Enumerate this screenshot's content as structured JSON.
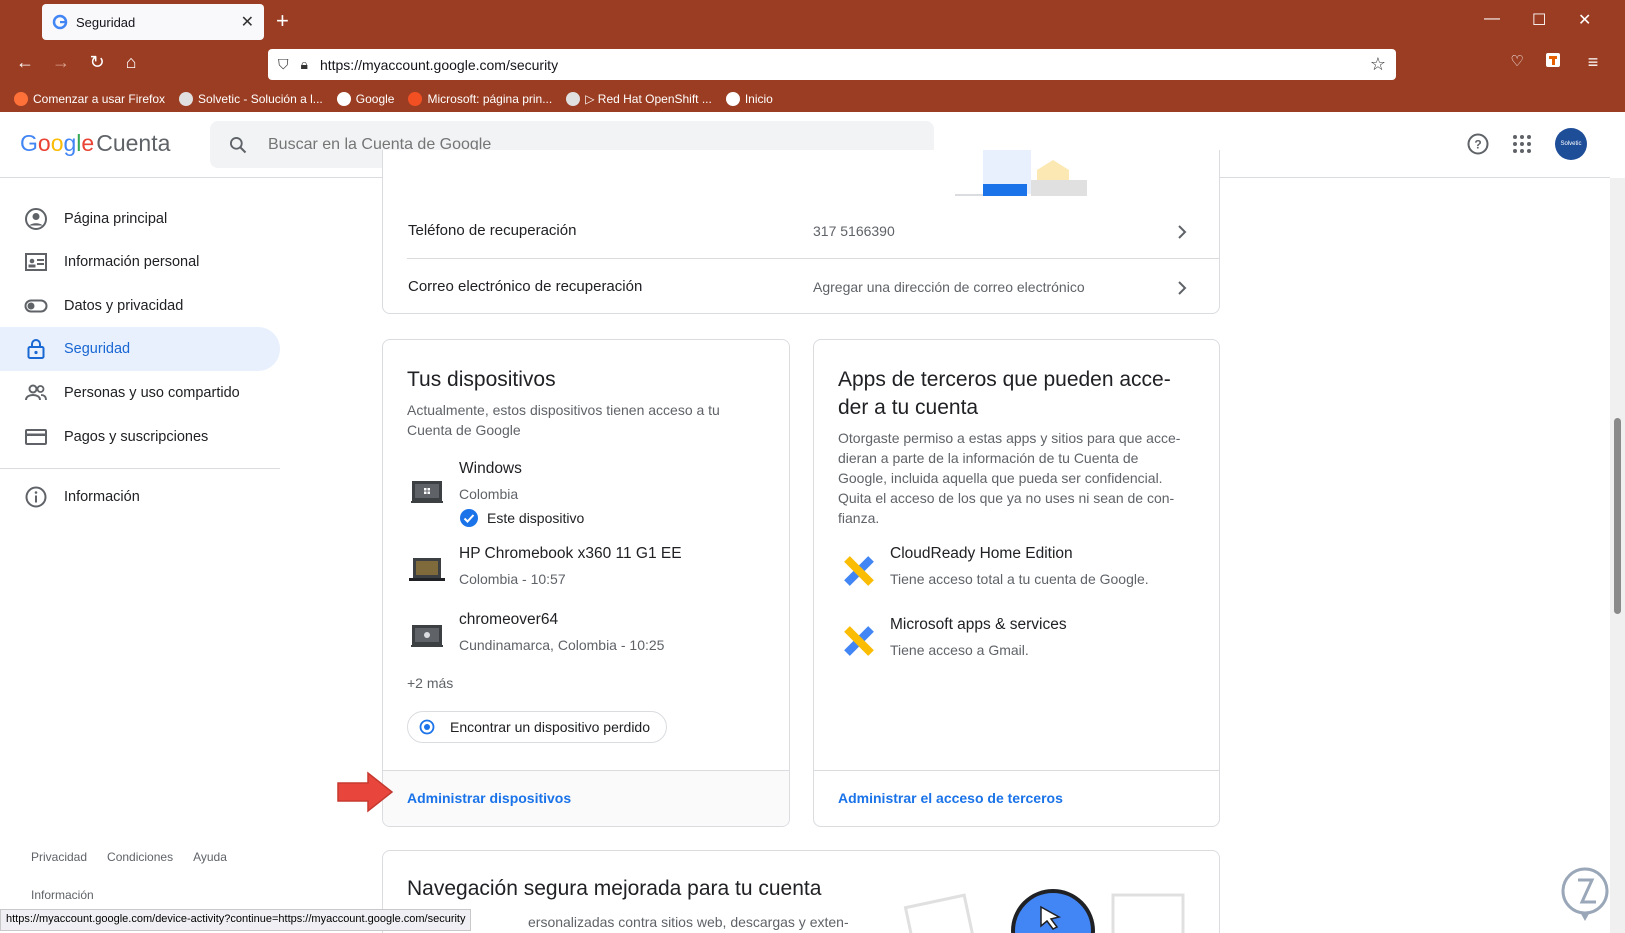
{
  "browser": {
    "tab_title": "Seguridad",
    "url": "https://myaccount.google.com/security",
    "bookmarks": [
      {
        "label": "Comenzar a usar Firefox",
        "color": "#ff7139"
      },
      {
        "label": "Solvetic - Solución a l...",
        "color": "#e0e0e0"
      },
      {
        "label": "Google",
        "color": "#ffffff"
      },
      {
        "label": "Microsoft: página prin...",
        "color": "#f25022"
      },
      {
        "label": "▷ Red Hat OpenShift ...",
        "color": "#e0e0e0"
      },
      {
        "label": "Inicio",
        "color": "#ffffff"
      }
    ],
    "status_url": "https://myaccount.google.com/device-activity?continue=https://myaccount.google.com/security"
  },
  "header": {
    "logo_google": "Google",
    "logo_cuenta": "Cuenta",
    "search_placeholder": "Buscar en la Cuenta de Google",
    "avatar_text": "Solvetic"
  },
  "sidebar": {
    "items": [
      {
        "label": "Página principal",
        "icon": "account-circle-icon"
      },
      {
        "label": "Información personal",
        "icon": "id-card-icon"
      },
      {
        "label": "Datos y privacidad",
        "icon": "toggle-icon"
      },
      {
        "label": "Seguridad",
        "icon": "lock-icon"
      },
      {
        "label": "Personas y uso compartido",
        "icon": "people-icon"
      },
      {
        "label": "Pagos y suscripciones",
        "icon": "credit-card-icon"
      }
    ],
    "info_label": "Información",
    "footer": {
      "privacy": "Privacidad",
      "terms": "Condiciones",
      "help": "Ayuda",
      "info": "Información"
    }
  },
  "recovery": {
    "phone_label": "Teléfono de recuperación",
    "phone_value": "317 5166390",
    "email_label": "Correo electrónico de recuperación",
    "email_value": "Agregar una dirección de correo electrónico"
  },
  "devices": {
    "title": "Tus dispositivos",
    "desc_1": "Actualmente, estos dispositivos tienen acceso a tu",
    "desc_2": "Cuenta de Google",
    "list": [
      {
        "name": "Windows",
        "sub": "Colombia",
        "badge": "Este dispositivo"
      },
      {
        "name": "HP Chromebook x360 11 G1 EE",
        "sub": "Colombia - 10:57"
      },
      {
        "name": "chromeover64",
        "sub": "Cundinamarca, Colombia - 10:25"
      }
    ],
    "more": "+2 más",
    "find_button": "Encontrar un dispositivo perdido",
    "manage_link": "Administrar dispositivos"
  },
  "third_party": {
    "title_1": "Apps de terceros que pueden acce-",
    "title_2": "der a tu cuenta",
    "desc": [
      "Otorgaste permiso a estas apps y sitios para que acce-",
      "dieran a parte de la información de tu Cuenta de",
      "Google, incluida aquella que pueda ser confidencial.",
      "Quita el acceso de los que ya no uses ni sean de con-",
      "fianza."
    ],
    "apps": [
      {
        "name": "CloudReady Home Edition",
        "sub": "Tiene acceso total a tu cuenta de Google."
      },
      {
        "name": "Microsoft apps & services",
        "sub": "Tiene acceso a Gmail."
      }
    ],
    "manage_link": "Administrar el acceso de terceros"
  },
  "safe_browsing": {
    "title": "Navegación segura mejorada para tu cuenta",
    "desc": "ersonalizadas contra sitios web, descargas y exten-"
  },
  "colors": {
    "accent": "#1a73e8",
    "chrome": "#9b3d22",
    "active_bg": "#e8f0fe",
    "arrow": "#e8453c"
  }
}
